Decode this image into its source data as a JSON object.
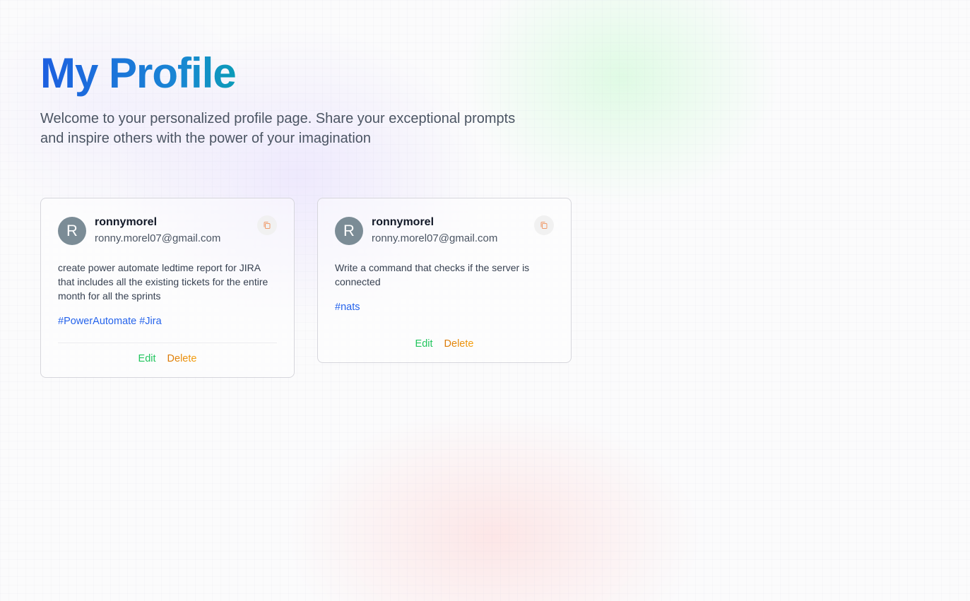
{
  "page": {
    "title": "My Profile",
    "subtitle": "Welcome to your personalized profile page. Share your exceptional prompts and inspire others with the power of your imagination"
  },
  "colors": {
    "title_gradient_start": "#1d5fe0",
    "title_gradient_end": "#0b9bb8",
    "tag": "#2563eb",
    "edit": "#22c55e",
    "delete": "#f59e0b",
    "avatar_bg": "#7b8c96"
  },
  "posts": [
    {
      "avatar_initial": "R",
      "username": "ronnymorel",
      "email": "ronny.morel07@gmail.com",
      "prompt": "create power automate ledtime report for JIRA that includes all the existing tickets for the entire month for all the sprints",
      "tags": [
        "#PowerAutomate",
        "#Jira"
      ],
      "edit_label": "Edit",
      "delete_label": "Delete",
      "copy_icon": "copy-icon"
    },
    {
      "avatar_initial": "R",
      "username": "ronnymorel",
      "email": "ronny.morel07@gmail.com",
      "prompt": "Write a command that checks if the server is connected",
      "tags": [
        "#nats"
      ],
      "edit_label": "Edit",
      "delete_label": "Delete",
      "copy_icon": "copy-icon"
    }
  ]
}
